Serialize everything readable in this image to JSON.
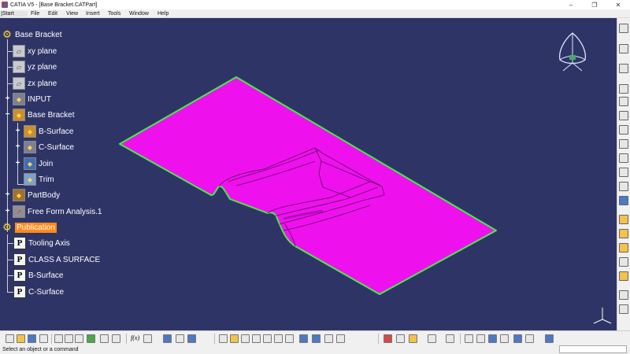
{
  "window": {
    "title": "CATIA V5 - [Base Bracket.CATPart]",
    "minimize": "–",
    "maximize": "❐",
    "close": "✕"
  },
  "menu": [
    "Start",
    "File",
    "Edit",
    "View",
    "Insert",
    "Tools",
    "Window",
    "Help"
  ],
  "tree": {
    "root": "Base Bracket",
    "xy_plane": "xy plane",
    "yz_plane": "yz plane",
    "zx_plane": "zx plane",
    "input": "INPUT",
    "geoset": "Base Bracket",
    "b_surface": "B-Surface",
    "c_surface": "C-Surface",
    "join": "Join",
    "trim": "Trim",
    "partbody": "PartBody",
    "ffa": "Free Form Analysis.1",
    "publication": "Publication",
    "pub_tooling": "Tooling Axis",
    "pub_class_a": "CLASS A SURFACE",
    "pub_b_surface": "B-Surface",
    "pub_c_surface": "C-Surface"
  },
  "icons": {
    "root": "part-icon",
    "planes": "plane-icon",
    "geoset": "geometrical-set-icon",
    "publication": "publication-icon",
    "publish_item": "publish-icon",
    "compass": "compass-icon",
    "axis": "axis-system-icon"
  },
  "toolbar": {
    "fx_label": "f(x)"
  },
  "statusbar": {
    "message": "Select an object or a command"
  },
  "colors": {
    "background": "#2e3566",
    "surface": "#ee11ee",
    "surface_edge": "#44ee44",
    "selection": "#ff8a1a"
  }
}
